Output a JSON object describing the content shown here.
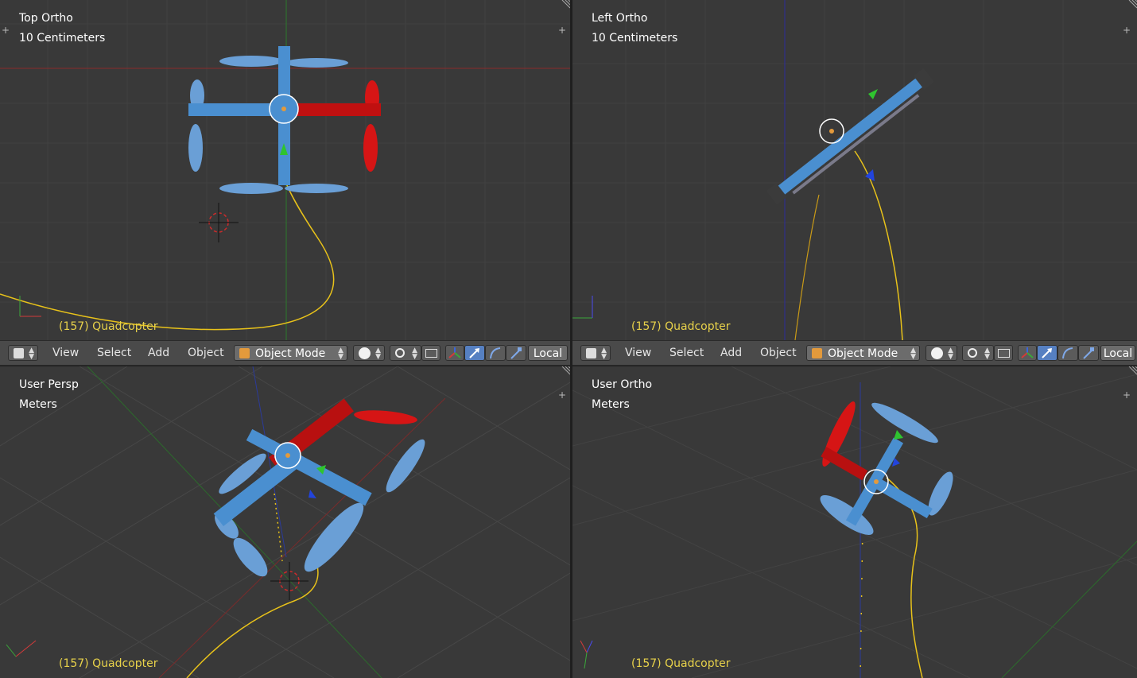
{
  "viewports": [
    {
      "id": "top-left",
      "title": "Top Ortho",
      "scale": "10 Centimeters",
      "object": "(157) Quadcopter"
    },
    {
      "id": "top-right",
      "title": "Left Ortho",
      "scale": "10 Centimeters",
      "object": "(157) Quadcopter"
    },
    {
      "id": "bottom-left",
      "title": "User Persp",
      "scale": "Meters",
      "object": "(157) Quadcopter"
    },
    {
      "id": "bottom-right",
      "title": "User Ortho",
      "scale": "Meters",
      "object": "(157) Quadcopter"
    }
  ],
  "headers": [
    {
      "menus": [
        "View",
        "Select",
        "Add",
        "Object"
      ],
      "mode": "Object Mode",
      "orientation": "Local"
    },
    {
      "menus": [
        "View",
        "Select",
        "Add",
        "Object"
      ],
      "mode": "Object Mode",
      "orientation": "Local"
    }
  ],
  "colors": {
    "viewport_bg": "#393939",
    "selected_blue": "#5b9bd5",
    "active_red": "#d01010",
    "path_yellow": "#e8c21a",
    "header_bg": "#4a4a4a"
  },
  "icons": [
    "editor-type-icon",
    "shading-sphere-icon",
    "pivot-icon",
    "manipulator-icon",
    "translate-icon",
    "rotate-icon",
    "scale-icon",
    "plus-icon",
    "cube-icon"
  ]
}
